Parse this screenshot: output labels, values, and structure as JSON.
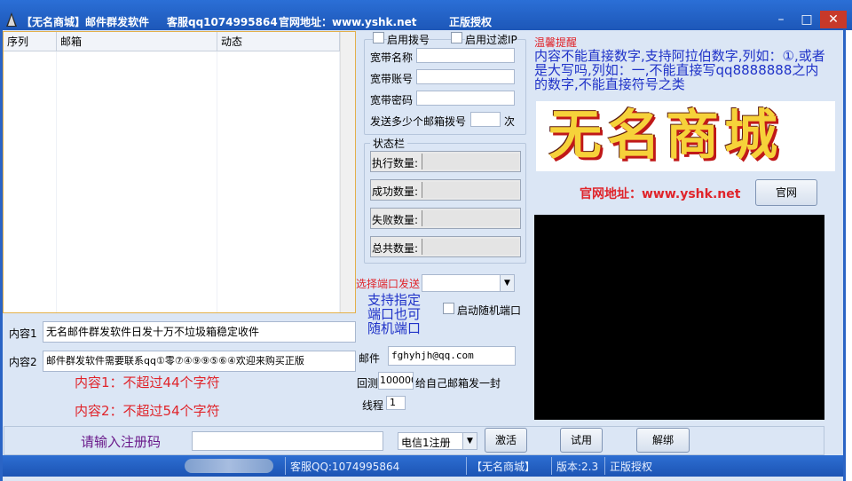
{
  "title_bar": {
    "app_name": "【无名商城】邮件群发软件",
    "support_qq": "客服qq1074995864",
    "website": "官网地址：www.yshk.net",
    "license": "正版授权",
    "minimize": "–",
    "maximize": "□",
    "close": "✕"
  },
  "list": {
    "columns": [
      "序列",
      "邮箱",
      "动态"
    ]
  },
  "dial_group": {
    "enable_dial": "启用拨号",
    "enable_filter_ip": "启用过滤IP",
    "broadband_name": "宽带名称",
    "broadband_account": "宽带账号",
    "broadband_password": "宽带密码",
    "send_prefix": "发送多少个邮箱拨号",
    "send_suffix": "次"
  },
  "status_group": {
    "title": "状态栏",
    "executed": "执行数量:",
    "success": "成功数量:",
    "failed": "失败数量:",
    "total": "总共数量:"
  },
  "port": {
    "label": "选择端口发送",
    "hint_line1": "支持指定",
    "hint_line2": "端口也可",
    "hint_line3": "随机端口",
    "random_port": "启动随机端口"
  },
  "content": {
    "label1": "内容1",
    "value1": "无名邮件群发软件日发十万不垃圾箱稳定收件",
    "label2": "内容2",
    "value2": "邮件群发软件需要联系qq①零⑦④⑨⑨⑤⑥④欢迎来购买正版",
    "limit1": "内容1：不超过44个字符",
    "limit2": "内容2：不超过54个字符"
  },
  "mail": {
    "label": "邮件",
    "value": "fghyhjh@qq.com",
    "reply_label": "回测",
    "reply_value": "100000",
    "reply_suffix": "给自己邮箱发一封",
    "thread_label": "线程",
    "thread_value": "1"
  },
  "notice": {
    "title": "温馨提醒",
    "body": "内容不能直接数字,支持阿拉伯数字,列如：①,或者是大写吗,列如：一,不能直接写qq8888888之内的数字,不能直接符号之类"
  },
  "logo": {
    "text": "无名商城"
  },
  "website_row": {
    "label": "官网地址：www.yshk.net",
    "button": "官网"
  },
  "register": {
    "prompt": "请输入注册码",
    "combo_value": "电信1注册",
    "activate": "激活",
    "trial": "试用",
    "unbind": "解绑"
  },
  "statusbar": {
    "support_qq": "客服QQ:1074995864",
    "brand": "【无名商城】",
    "version": "版本:2.3",
    "license": "正版授权"
  },
  "colors": {
    "titlebar": "#2b6fd6",
    "client_bg": "#dbe6f5",
    "warning_red": "#e0242a",
    "hint_blue": "#1f32c8"
  }
}
